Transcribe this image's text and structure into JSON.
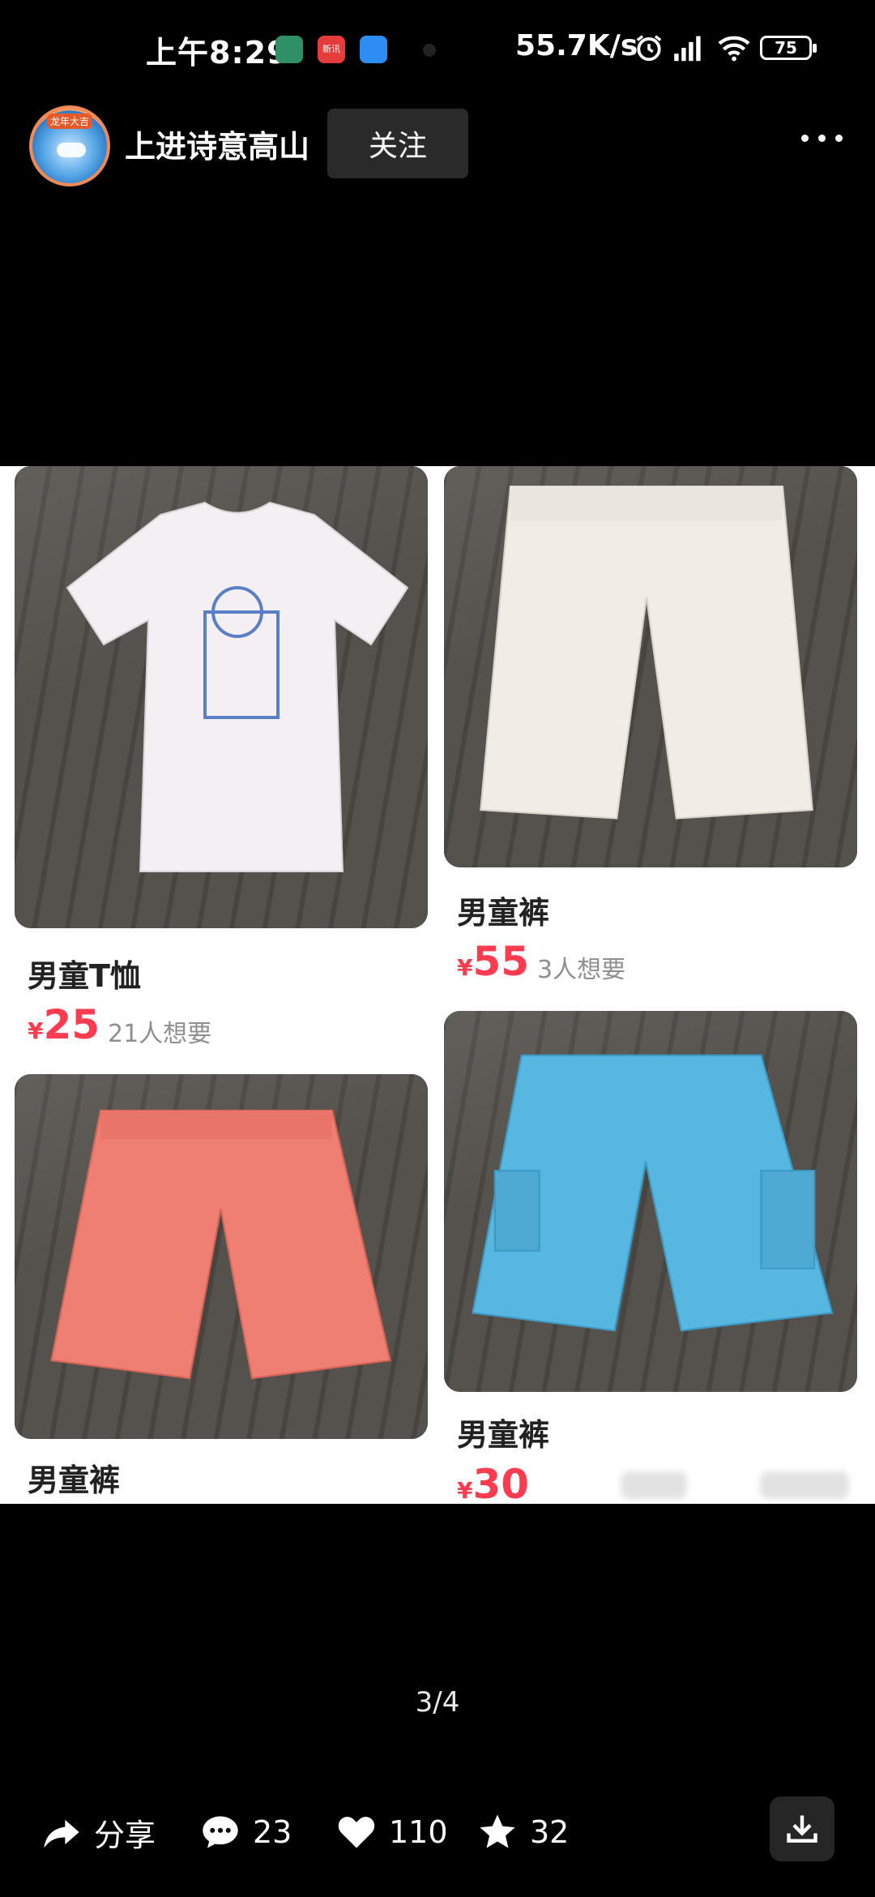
{
  "status": {
    "time": "上午8:29",
    "app_badge": "新讯",
    "net_speed": "55.7K/s",
    "battery": "75"
  },
  "header": {
    "username": "上进诗意高山",
    "avatar_tag": "龙年大吉",
    "follow_label": "关注"
  },
  "listings": [
    {
      "title": "男童T恤",
      "currency": "¥",
      "price": "25",
      "wants": "21人想要",
      "color": "#f2eef0"
    },
    {
      "title": "男童裤",
      "currency": "¥",
      "price": "55",
      "wants": "3人想要",
      "color": "#f3efe8"
    },
    {
      "title": "男童裤",
      "currency": "",
      "price": "",
      "wants": "",
      "color": "#ef7f72"
    },
    {
      "title": "男童裤",
      "currency": "¥",
      "price": "30",
      "wants": "",
      "color": "#58b7e0"
    }
  ],
  "pager": "3/4",
  "actions": {
    "share_label": "分享",
    "comment_count": "23",
    "like_count": "110",
    "favorite_count": "32"
  },
  "icons": [
    "share-icon",
    "comment-icon",
    "like-icon",
    "favorite-icon",
    "download-icon",
    "more-icon",
    "wifi-icon",
    "signal-icon",
    "alarm-icon"
  ],
  "colors": {
    "price": "#ff3b4f",
    "background": "#000000",
    "follow_button": "#2a2a2a"
  }
}
